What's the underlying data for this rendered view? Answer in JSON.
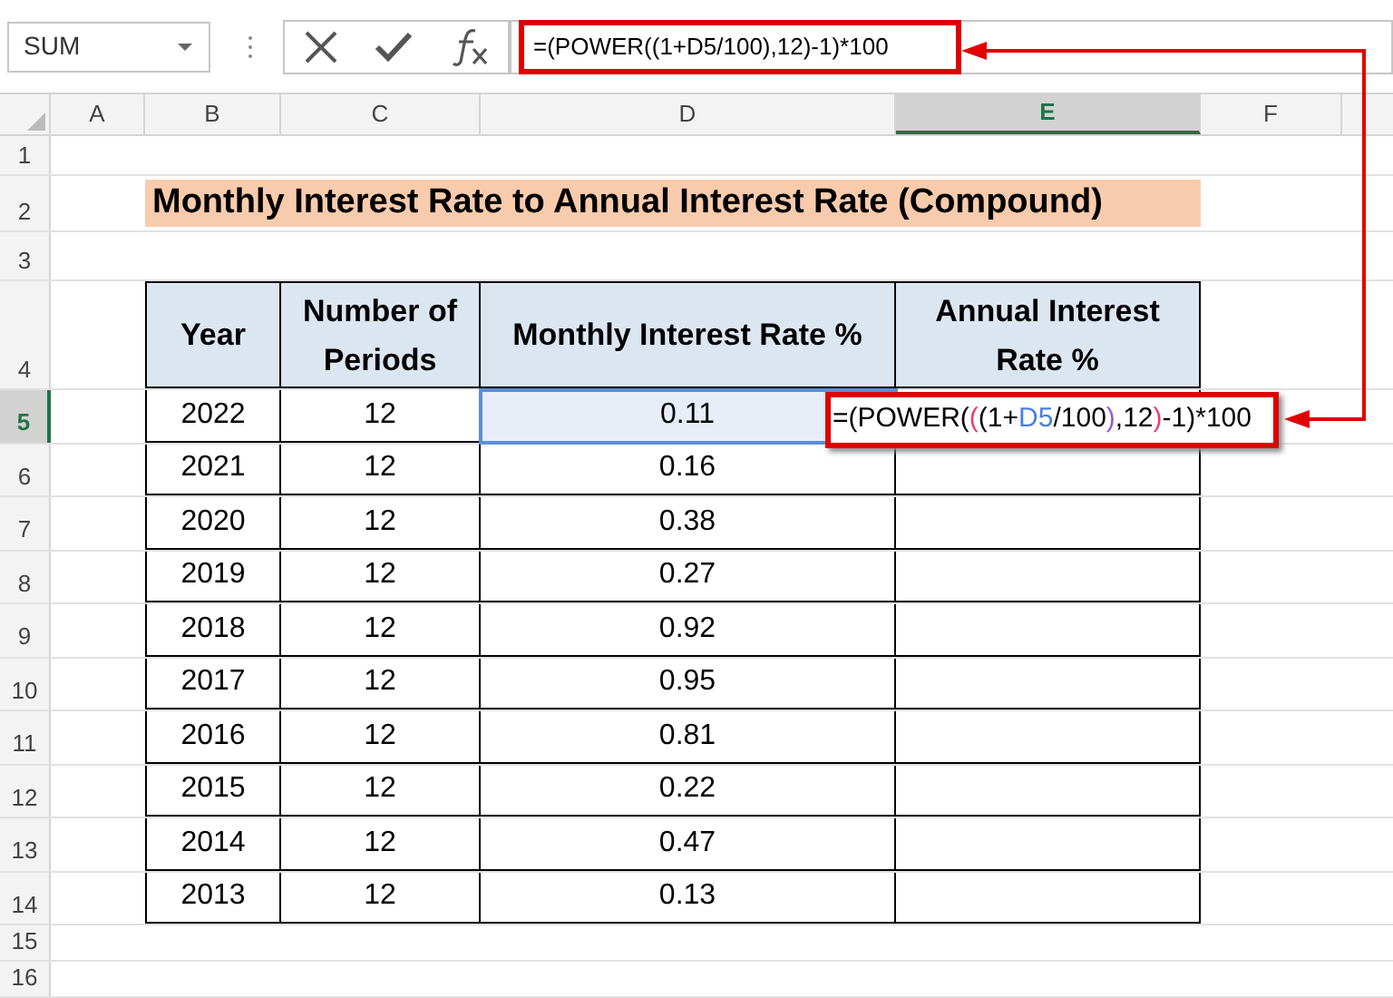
{
  "formula_bar": {
    "name_box": "SUM",
    "formula": "=(POWER((1+D5/100),12)-1)*100"
  },
  "columns": [
    {
      "label": "A",
      "selected": false
    },
    {
      "label": "B",
      "selected": false
    },
    {
      "label": "C",
      "selected": false
    },
    {
      "label": "D",
      "selected": false
    },
    {
      "label": "E",
      "selected": true
    },
    {
      "label": "F",
      "selected": false
    }
  ],
  "rows": [
    {
      "label": "1",
      "selected": false
    },
    {
      "label": "2",
      "selected": false
    },
    {
      "label": "3",
      "selected": false
    },
    {
      "label": "4",
      "selected": false
    },
    {
      "label": "5",
      "selected": true
    },
    {
      "label": "6",
      "selected": false
    },
    {
      "label": "7",
      "selected": false
    },
    {
      "label": "8",
      "selected": false
    },
    {
      "label": "9",
      "selected": false
    },
    {
      "label": "10",
      "selected": false
    },
    {
      "label": "11",
      "selected": false
    },
    {
      "label": "12",
      "selected": false
    },
    {
      "label": "13",
      "selected": false
    },
    {
      "label": "14",
      "selected": false
    },
    {
      "label": "15",
      "selected": false
    },
    {
      "label": "16",
      "selected": false
    }
  ],
  "title": "Monthly Interest Rate to Annual Interest Rate (Compound)",
  "table": {
    "columns": [
      "Year",
      "Number of Periods",
      "Monthly Interest Rate %",
      "Annual Interest Rate %"
    ],
    "rows": [
      {
        "year": "2022",
        "periods": "12",
        "monthly": "0.11",
        "selected": true
      },
      {
        "year": "2021",
        "periods": "12",
        "monthly": "0.16",
        "selected": false
      },
      {
        "year": "2020",
        "periods": "12",
        "monthly": "0.38",
        "selected": false
      },
      {
        "year": "2019",
        "periods": "12",
        "monthly": "0.27",
        "selected": false
      },
      {
        "year": "2018",
        "periods": "12",
        "monthly": "0.92",
        "selected": false
      },
      {
        "year": "2017",
        "periods": "12",
        "monthly": "0.95",
        "selected": false
      },
      {
        "year": "2016",
        "periods": "12",
        "monthly": "0.81",
        "selected": false
      },
      {
        "year": "2015",
        "periods": "12",
        "monthly": "0.22",
        "selected": false
      },
      {
        "year": "2014",
        "periods": "12",
        "monthly": "0.47",
        "selected": false
      },
      {
        "year": "2013",
        "periods": "12",
        "monthly": "0.13",
        "selected": false
      }
    ]
  },
  "editing_cell": {
    "segments": [
      {
        "text": "=(POWER(",
        "color": "#000000"
      },
      {
        "text": "(",
        "color": "#e0407a"
      },
      {
        "text": "(1+",
        "color": "#000000"
      },
      {
        "text": "D5",
        "color": "#4a7fe0"
      },
      {
        "text": "/100",
        "color": "#000000"
      },
      {
        "text": ")",
        "color": "#9b59d0"
      },
      {
        "text": ",12",
        "color": "#000000"
      },
      {
        "text": ")",
        "color": "#e0407a"
      },
      {
        "text": "-1)*100",
        "color": "#000000"
      }
    ]
  }
}
